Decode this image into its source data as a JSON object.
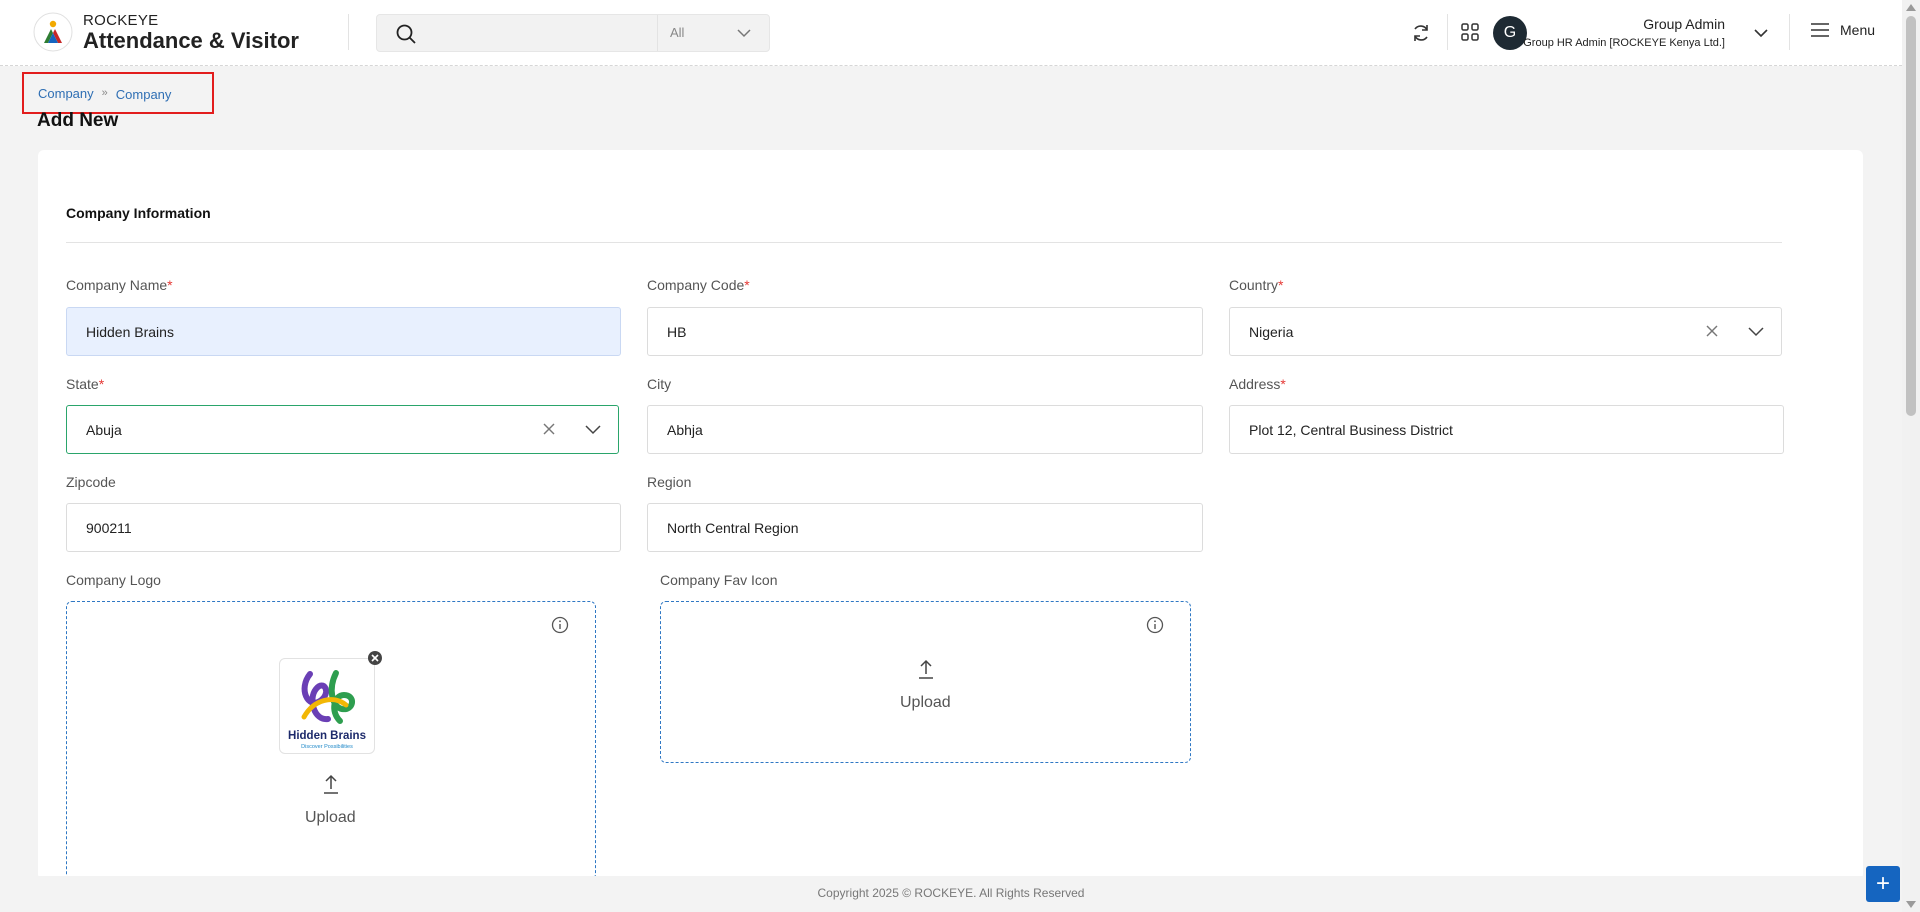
{
  "header": {
    "brand_small": "ROCKEYE",
    "brand_big": "Attendance & Visitor",
    "search": {
      "placeholder": "",
      "filter_value": "All"
    },
    "user": {
      "avatar_letter": "G",
      "name": "Group Admin",
      "role": "Group HR Admin [ROCKEYE Kenya Ltd.]"
    },
    "menu_label": "Menu"
  },
  "breadcrumb": {
    "items": [
      "Company",
      "Company"
    ]
  },
  "page_title": "Add New",
  "form": {
    "section_title": "Company Information",
    "company_name": {
      "label": "Company Name",
      "required": "*",
      "value": "Hidden Brains"
    },
    "company_code": {
      "label": "Company Code",
      "required": "*",
      "value": "HB"
    },
    "country": {
      "label": "Country",
      "required": "*",
      "value": "Nigeria"
    },
    "state": {
      "label": "State",
      "required": "*",
      "value": "Abuja"
    },
    "city": {
      "label": "City",
      "value": "Abhja"
    },
    "address": {
      "label": "Address",
      "required": "*",
      "value": "Plot 12, Central Business District"
    },
    "zipcode": {
      "label": "Zipcode",
      "value": "900211"
    },
    "region": {
      "label": "Region",
      "value": "North Central Region"
    },
    "company_logo": {
      "label": "Company Logo",
      "upload_label": "Upload",
      "preview_title": "Hidden Brains",
      "preview_tagline": "Discover Possibilities"
    },
    "company_fav_icon": {
      "label": "Company Fav Icon",
      "upload_label": "Upload"
    }
  },
  "footer": {
    "copyright": "Copyright 2025 © ROCKEYE. All Rights Reserved",
    "fab_symbol": "+"
  },
  "colors": {
    "accent_blue": "#2f6fb4",
    "required_red": "#e53935",
    "active_green": "#2aa56b",
    "highlight_red": "#e21d1d"
  }
}
